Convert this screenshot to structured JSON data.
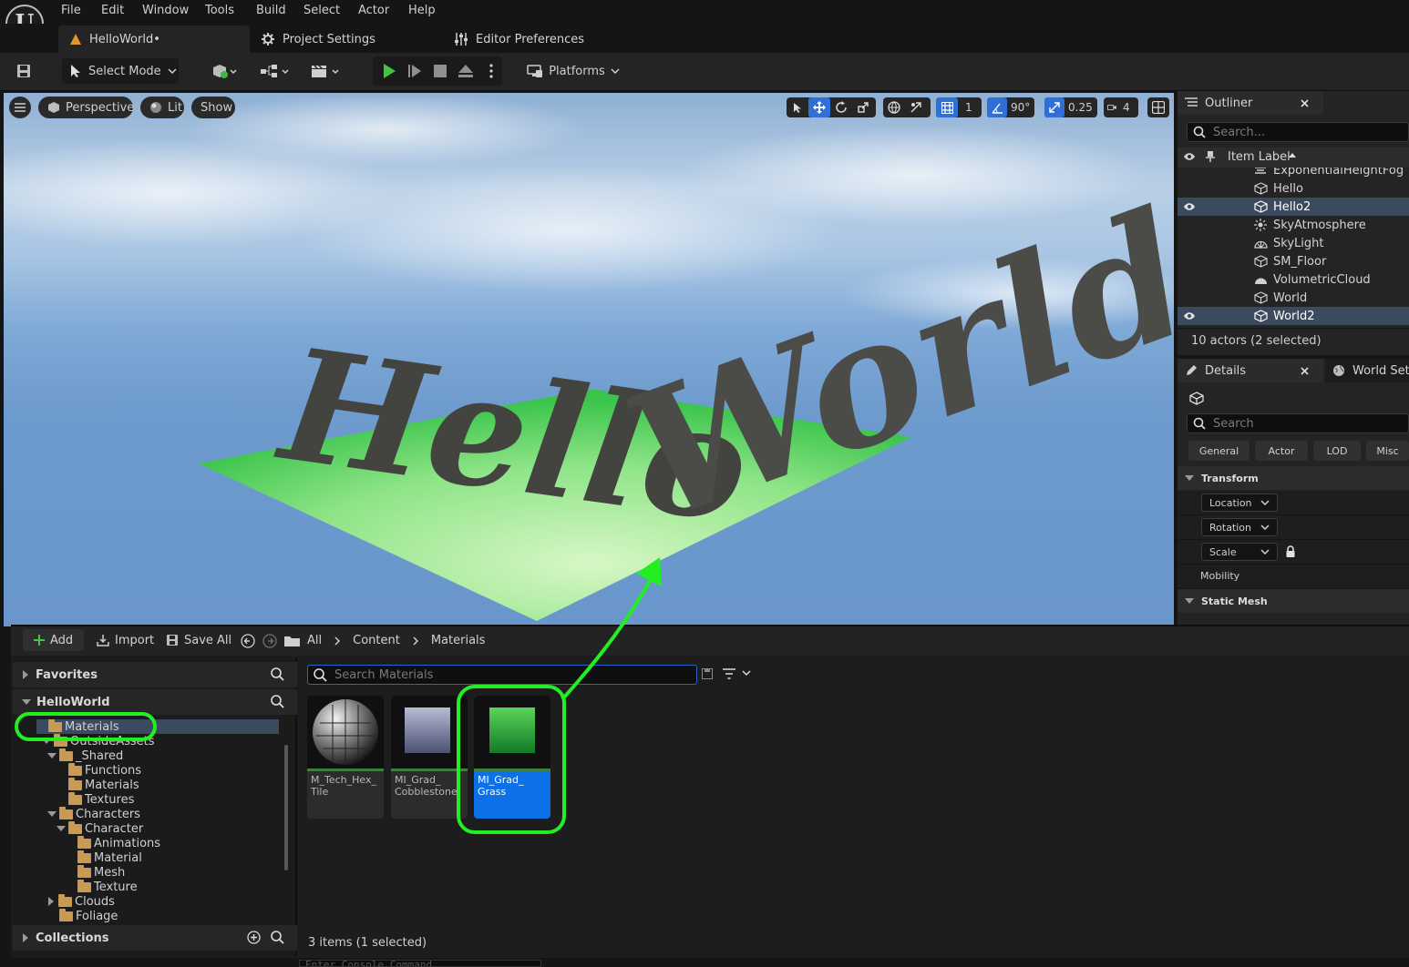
{
  "app": {
    "logo_letter": "U",
    "menu": [
      "File",
      "Edit",
      "Window",
      "Tools",
      "Build",
      "Select",
      "Actor",
      "Help"
    ]
  },
  "tabs": [
    {
      "label": "HelloWorld•",
      "icon": "level-icon"
    },
    {
      "label": "Project Settings",
      "icon": "settings-icon"
    },
    {
      "label": "Editor Preferences",
      "icon": "sliders-icon"
    }
  ],
  "toolbar": {
    "mode_label": "Select Mode",
    "platforms_label": "Platforms"
  },
  "viewport": {
    "perspective_label": "Perspective",
    "lit_label": "Lit",
    "show_label": "Show",
    "grid_value": "1",
    "angle_value": "90°",
    "scale_value": "0.25",
    "camera_speed": "4",
    "scene_text_left": "Hello",
    "scene_text_right": "World"
  },
  "outliner": {
    "title": "Outliner",
    "search_placeholder": "Search...",
    "column_label": "Item Label",
    "rows": [
      {
        "label": "ExponentialHeightFog",
        "icon": "fog-icon",
        "selected": false
      },
      {
        "label": "Hello",
        "icon": "mesh-icon",
        "selected": false
      },
      {
        "label": "Hello2",
        "icon": "mesh-icon",
        "selected": true
      },
      {
        "label": "SkyAtmosphere",
        "icon": "sun-icon",
        "selected": false
      },
      {
        "label": "SkyLight",
        "icon": "skylight-icon",
        "selected": false
      },
      {
        "label": "SM_Floor",
        "icon": "mesh-icon",
        "selected": false
      },
      {
        "label": "VolumetricCloud",
        "icon": "cloud-icon",
        "selected": false
      },
      {
        "label": "World",
        "icon": "mesh-icon",
        "selected": false
      },
      {
        "label": "World2",
        "icon": "mesh-icon",
        "selected": true
      }
    ],
    "status": "10 actors (2 selected)"
  },
  "details": {
    "title": "Details",
    "second_tab": "World Settin",
    "search_placeholder": "Search",
    "categories": [
      "General",
      "Actor",
      "LOD",
      "Misc"
    ],
    "transform_header": "Transform",
    "location_label": "Location",
    "rotation_label": "Rotation",
    "scale_label": "Scale",
    "mobility_label": "Mobility",
    "static_mesh_header": "Static Mesh"
  },
  "content_browser": {
    "add_label": "Add",
    "import_label": "Import",
    "save_all_label": "Save All",
    "breadcrumb": [
      "All",
      "Content",
      "Materials"
    ],
    "search_placeholder": "Search Materials",
    "favorites_label": "Favorites",
    "project_label": "HelloWorld",
    "collections_label": "Collections",
    "tree": [
      {
        "label": "Materials",
        "depth": 0,
        "expanded": false,
        "selected": true
      },
      {
        "label": "OutsideAssets",
        "depth": 1,
        "expanded": true,
        "selected": false
      },
      {
        "label": "_Shared",
        "depth": 1,
        "expanded": true,
        "selected": false
      },
      {
        "label": "Functions",
        "depth": 2,
        "expanded": false,
        "selected": false
      },
      {
        "label": "Materials",
        "depth": 2,
        "expanded": false,
        "selected": false
      },
      {
        "label": "Textures",
        "depth": 2,
        "expanded": false,
        "selected": false
      },
      {
        "label": "Characters",
        "depth": 1,
        "expanded": true,
        "selected": false
      },
      {
        "label": "Character",
        "depth": 2,
        "expanded": true,
        "selected": false
      },
      {
        "label": "Animations",
        "depth": 3,
        "expanded": false,
        "selected": false
      },
      {
        "label": "Material",
        "depth": 3,
        "expanded": false,
        "selected": false
      },
      {
        "label": "Mesh",
        "depth": 3,
        "expanded": false,
        "selected": false
      },
      {
        "label": "Texture",
        "depth": 3,
        "expanded": false,
        "selected": false
      },
      {
        "label": "Clouds",
        "depth": 1,
        "expanded": false,
        "selected": false
      },
      {
        "label": "Foliage",
        "depth": 1,
        "expanded": false,
        "selected": false
      }
    ],
    "assets": [
      {
        "name": "M_Tech_Hex_ Tile",
        "selected": false
      },
      {
        "name": "MI_Grad_ Cobblestone",
        "selected": false
      },
      {
        "name": "MI_Grad_ Grass",
        "selected": true
      }
    ],
    "status": "3 items (1 selected)"
  },
  "bottom_bar": {
    "console_placeholder": "Enter Console Command"
  },
  "colors": {
    "accent": "#2f6fd6",
    "highlight": "#22ee22",
    "selection": "#0c70e6"
  }
}
